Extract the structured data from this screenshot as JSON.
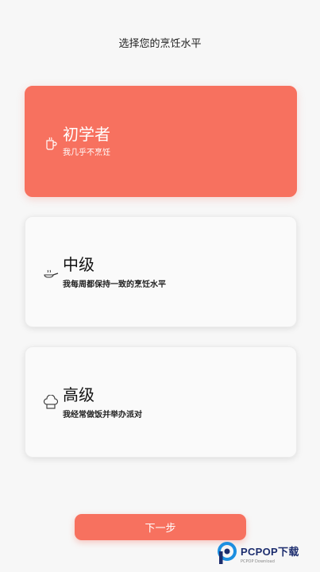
{
  "header": {
    "title": "选择您的烹饪水平"
  },
  "levels": [
    {
      "title": "初学者",
      "desc": "我几乎不烹饪",
      "icon": "mug-icon",
      "selected": true
    },
    {
      "title": "中级",
      "desc": "我每周都保持一致的烹饪水平",
      "icon": "frying-pan-icon",
      "selected": false
    },
    {
      "title": "高级",
      "desc": "我经常做饭并举办派对",
      "icon": "chef-hat-icon",
      "selected": false
    }
  ],
  "footer": {
    "next_label": "下一步"
  },
  "watermark": {
    "brand": "PCPOP下载",
    "sub": "PCPOP Download"
  },
  "colors": {
    "accent": "#f7715f",
    "background": "#f7f7f7",
    "card": "#fafafa"
  }
}
